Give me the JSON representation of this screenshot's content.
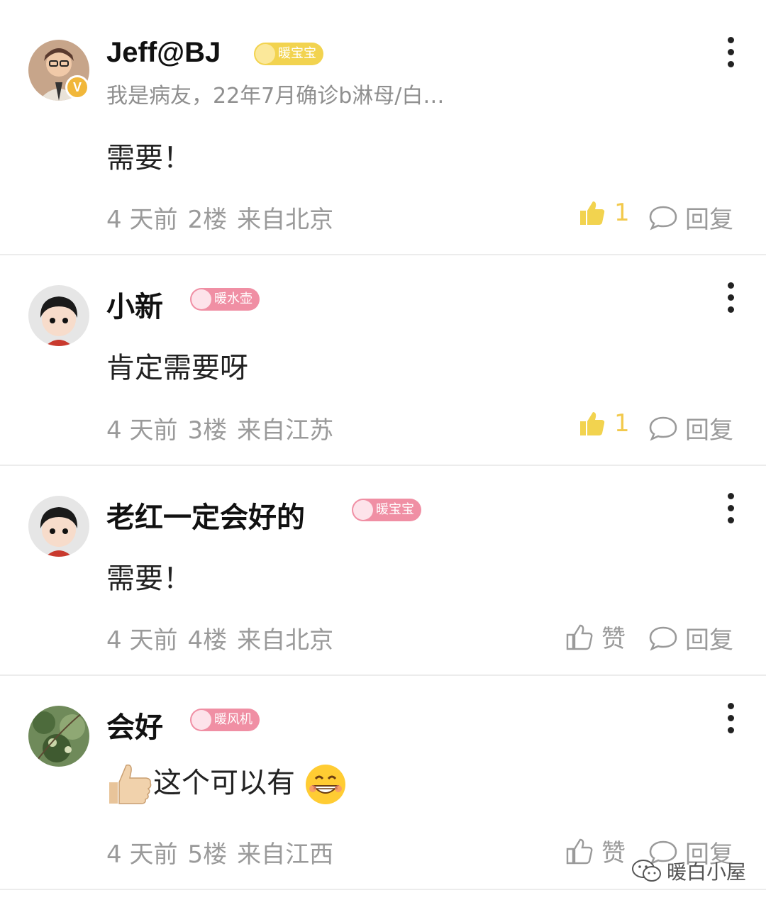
{
  "comments": [
    {
      "username": "Jeff@BJ",
      "badge": "暖宝宝",
      "bio": "我是病友，22年7月确诊b淋母/白…",
      "verified_mark": "V",
      "content": "需要！",
      "time": "4 天前",
      "floor": "2楼",
      "location": "来自北京",
      "likes": "1",
      "reply_label": "回复"
    },
    {
      "username": "小新",
      "badge": "暖水壶",
      "content": "肯定需要呀",
      "time": "4 天前",
      "floor": "3楼",
      "location": "来自江苏",
      "likes": "1",
      "reply_label": "回复"
    },
    {
      "username": "老红一定会好的",
      "badge": "暖宝宝",
      "content": "需要！",
      "time": "4 天前",
      "floor": "4楼",
      "location": "来自北京",
      "like_label": "赞",
      "reply_label": "回复"
    },
    {
      "username": "会好",
      "badge": "暖风机",
      "content": "这个可以有",
      "time": "4 天前",
      "floor": "5楼",
      "location": "来自江西",
      "like_label": "赞",
      "reply_label": "回复"
    }
  ],
  "watermark": "暖白小屋",
  "colors": {
    "liked": "#f2c94c",
    "meta": "#9a9a9a",
    "badge_gold": "#f2d34f",
    "badge_pink": "#f08fa4"
  },
  "icons": [
    "more-dots-icon",
    "thumb-up-icon",
    "comment-bubble-icon",
    "verified-icon",
    "wechat-icon"
  ]
}
